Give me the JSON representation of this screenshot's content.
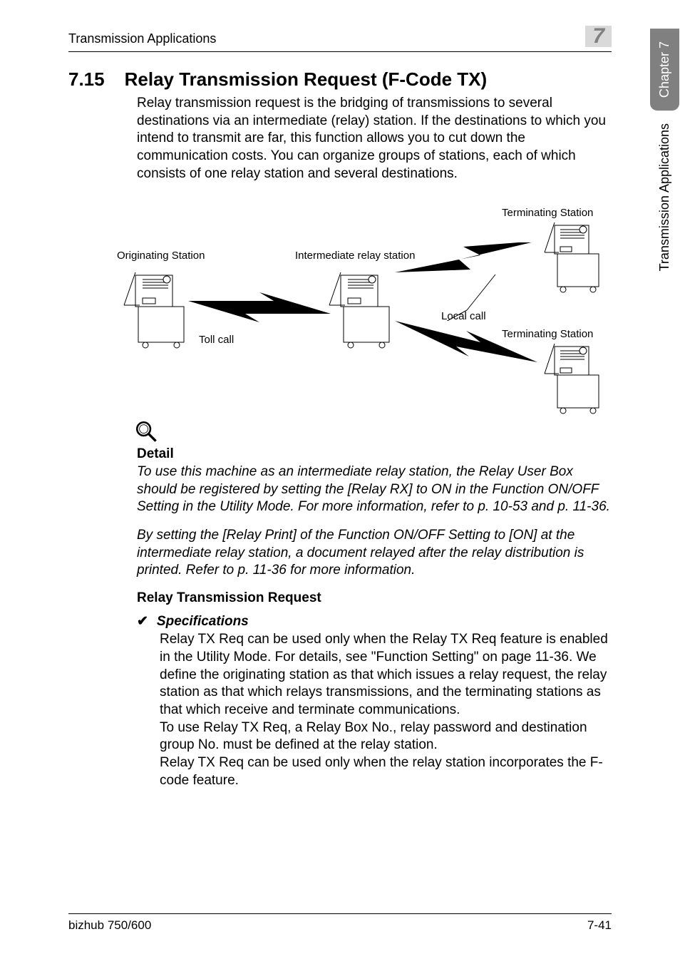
{
  "header": {
    "breadcrumb": "Transmission Applications",
    "chapter_number": "7"
  },
  "side": {
    "chapter_label": "Chapter 7",
    "section_label": "Transmission Applications"
  },
  "section": {
    "number": "7.15",
    "title": "Relay Transmission Request (F-Code TX)",
    "intro": "Relay transmission request is the bridging of transmissions to several destinations via an intermediate (relay) station. If the destinations to which you intend to transmit are far, this function allows you to cut down the communication costs. You can organize groups of stations, each of which consists of one relay station and several destinations."
  },
  "diagram": {
    "originating": "Originating Station",
    "intermediate": "Intermediate relay station",
    "terminating1": "Terminating Station",
    "terminating2": "Terminating Station",
    "toll": "Toll call",
    "local": "Local call"
  },
  "detail": {
    "heading": "Detail",
    "p1": "To use this machine as an intermediate relay station, the Relay User Box should be registered by setting the [Relay RX] to ON in the Function ON/OFF Setting in the Utility Mode. For more information, refer to p. 10-53 and p. 11-36.",
    "p2": "By setting the [Relay Print] of the Function ON/OFF Setting to [ON] at the intermediate relay station, a document relayed after the relay distribution is printed. Refer to p. 11-36 for more information."
  },
  "relay": {
    "heading": "Relay Transmission Request",
    "spec_label": "Specifications",
    "check": "✔",
    "body": "Relay TX Req can be used only when the Relay TX Req feature is enabled in the Utility Mode. For details, see \"Function Setting\" on page 11-36. We define the originating station as that which issues a relay request, the relay station as that which relays transmissions, and the terminating stations as that which receive and terminate communications.\nTo use Relay TX Req, a Relay Box No., relay password and destination group No. must be defined at the relay station.\nRelay TX Req can be used only when the relay station incorporates the F-code feature."
  },
  "footer": {
    "left": "bizhub 750/600",
    "right": "7-41"
  }
}
